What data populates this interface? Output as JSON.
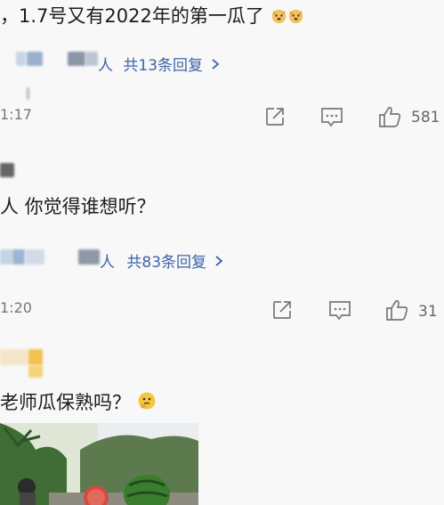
{
  "comments": [
    {
      "text": "，1.7号又有2022年的第一瓜了",
      "reply_author_suffix": "人",
      "replies_label": "共13条回复",
      "time": "1:17",
      "likes": "581",
      "emoji": "dog-face"
    },
    {
      "text": "人 你觉得谁想听？",
      "reply_author_suffix": "人",
      "replies_label": "共83条回复",
      "time": "1:20",
      "likes": "31"
    },
    {
      "text": "老师瓜保熟吗？",
      "emoji": "thinking-face"
    }
  ],
  "icons": {
    "share": "share-icon",
    "comment": "comment-icon",
    "like": "thumbs-up-icon",
    "chevron": "chevron-right-icon"
  },
  "colors": {
    "link": "#3d63a8",
    "background": "#f8f8f8",
    "text": "#1c1c1c",
    "muted": "#777777"
  }
}
